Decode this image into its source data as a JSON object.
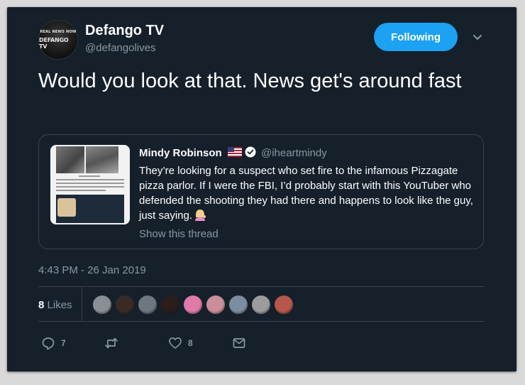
{
  "author": {
    "name": "Defango TV",
    "handle": "@defangolives",
    "avatar_top_text": "REAL NEWS NOW",
    "avatar_main_text": "DEFANGO TV"
  },
  "follow_button": {
    "label": "Following",
    "color": "#1da1f2"
  },
  "menu_icon": "chevron-down-icon",
  "tweet": {
    "text": "Would you look at that. News get's around fast",
    "timestamp": "4:43 PM - 26 Jan 2019"
  },
  "quoted_tweet": {
    "name": "Mindy Robinson",
    "handle": "@iheartmindy",
    "text": "They’re looking for a suspect who set fire to the infamous Pizzagate pizza parlor. If I were the FBI, I’d probably start with this YouTuber who defended the shooting they had there and happens to look like the guy, just saying.",
    "show_thread": "Show this thread",
    "icons": [
      "us-flag-icon",
      "verified-badge-icon",
      "woman-tipping-hand-emoji"
    ]
  },
  "likes": {
    "count": "8",
    "label": "Likes"
  },
  "likers": [
    "#8a8f94",
    "#3a2a25",
    "#6e7780",
    "#2a1d1a",
    "#e07aa8",
    "#c98e9a",
    "#7d8da0",
    "#9c9c9c",
    "#b5574a"
  ],
  "actions": [
    {
      "icon": "reply-icon",
      "count": "7"
    },
    {
      "icon": "retweet-icon",
      "count": ""
    },
    {
      "icon": "heart-icon",
      "count": "8"
    },
    {
      "icon": "mail-icon",
      "count": ""
    }
  ],
  "colors": {
    "background": "#15202b",
    "border": "#38444d",
    "secondary_text": "#8899a6"
  }
}
